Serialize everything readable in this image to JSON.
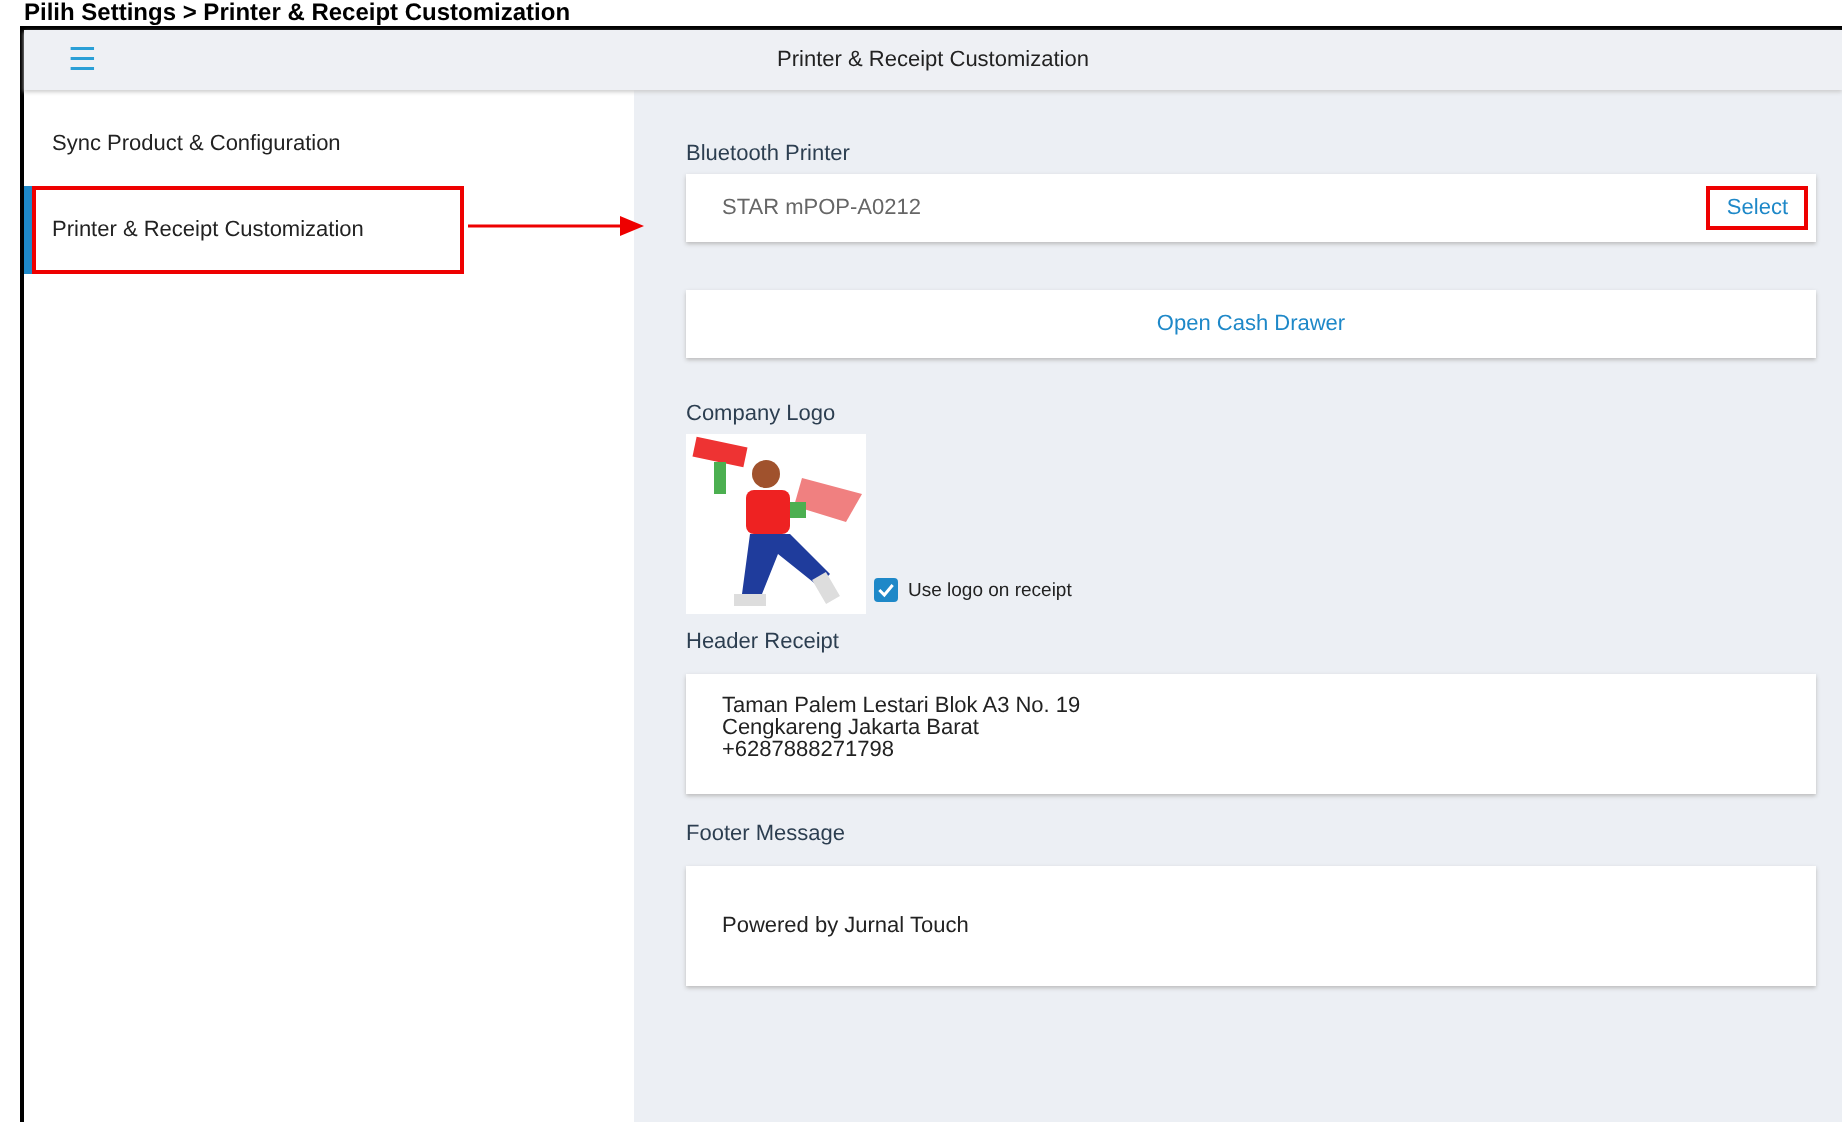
{
  "caption": "Pilih Settings > Printer & Receipt Customization",
  "app_bar": {
    "menu_icon": "☰",
    "title": "Printer & Receipt Customization"
  },
  "sidebar": {
    "items": [
      {
        "label": "Sync Product & Configuration",
        "selected": false,
        "highlighted": false
      },
      {
        "label": "Printer & Receipt Customization",
        "selected": true,
        "highlighted": true
      }
    ]
  },
  "bluetooth_printer": {
    "label": "Bluetooth Printer",
    "value": "STAR mPOP-A0212",
    "action": {
      "label": "Select",
      "highlighted": true
    }
  },
  "cash_drawer_button": "Open Cash Drawer",
  "company_logo": {
    "label": "Company Logo",
    "use_logo": {
      "label": "Use logo on receipt",
      "checked": true
    }
  },
  "header_receipt": {
    "label": "Header Receipt",
    "lines": [
      "Taman Palem Lestari Blok A3 No. 19",
      "Cengkareng Jakarta Barat",
      "+6287888271798"
    ]
  },
  "footer_message": {
    "label": "Footer Message",
    "value": "Powered by Jurnal Touch"
  }
}
